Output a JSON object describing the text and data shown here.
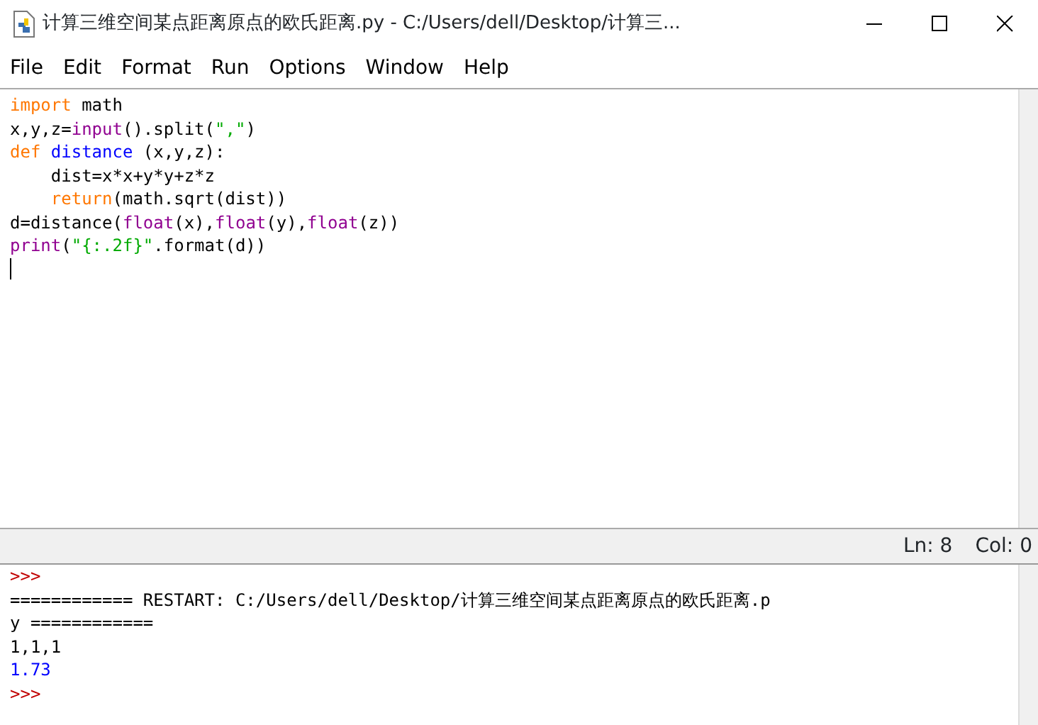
{
  "window": {
    "title": "计算三维空间某点距离原点的欧氏距离.py - C:/Users/dell/Desktop/计算三..."
  },
  "menu": [
    "File",
    "Edit",
    "Format",
    "Run",
    "Options",
    "Window",
    "Help"
  ],
  "editor": {
    "lines": [
      [
        {
          "kind": "keyword",
          "text": "import"
        },
        {
          "kind": "plain",
          "text": " math"
        }
      ],
      [
        {
          "kind": "plain",
          "text": "x,y,z="
        },
        {
          "kind": "builtin",
          "text": "input"
        },
        {
          "kind": "plain",
          "text": "().split("
        },
        {
          "kind": "string",
          "text": "\",\""
        },
        {
          "kind": "plain",
          "text": ")"
        }
      ],
      [
        {
          "kind": "keyword",
          "text": "def "
        },
        {
          "kind": "defname",
          "text": "distance"
        },
        {
          "kind": "plain",
          "text": " (x,y,z):"
        }
      ],
      [
        {
          "kind": "plain",
          "text": "    dist=x*x+y*y+z*z"
        }
      ],
      [
        {
          "kind": "keyword",
          "text": "    return"
        },
        {
          "kind": "plain",
          "text": "(math.sqrt(dist))"
        }
      ],
      [
        {
          "kind": "plain",
          "text": "d=distance("
        },
        {
          "kind": "builtin",
          "text": "float"
        },
        {
          "kind": "plain",
          "text": "(x),"
        },
        {
          "kind": "builtin",
          "text": "float"
        },
        {
          "kind": "plain",
          "text": "(y),"
        },
        {
          "kind": "builtin",
          "text": "float"
        },
        {
          "kind": "plain",
          "text": "(z))"
        }
      ],
      [
        {
          "kind": "builtin",
          "text": "print"
        },
        {
          "kind": "plain",
          "text": "("
        },
        {
          "kind": "string",
          "text": "\"{:.2f}\""
        },
        {
          "kind": "plain",
          "text": ".format(d))"
        }
      ]
    ]
  },
  "status_bar": {
    "line": "Ln: 8",
    "column": "Col: 0"
  },
  "shell": {
    "lines": [
      {
        "kind": "prompt",
        "text": ">>>"
      },
      {
        "kind": "output",
        "text": "============ RESTART: C:/Users/dell/Desktop/计算三维空间某点距离原点的欧氏距离.p"
      },
      {
        "kind": "output",
        "text": "y ============"
      },
      {
        "kind": "input",
        "text": "1,1,1"
      },
      {
        "kind": "result",
        "text": "1.73"
      },
      {
        "kind": "prompt",
        "text": ">>>"
      }
    ]
  }
}
